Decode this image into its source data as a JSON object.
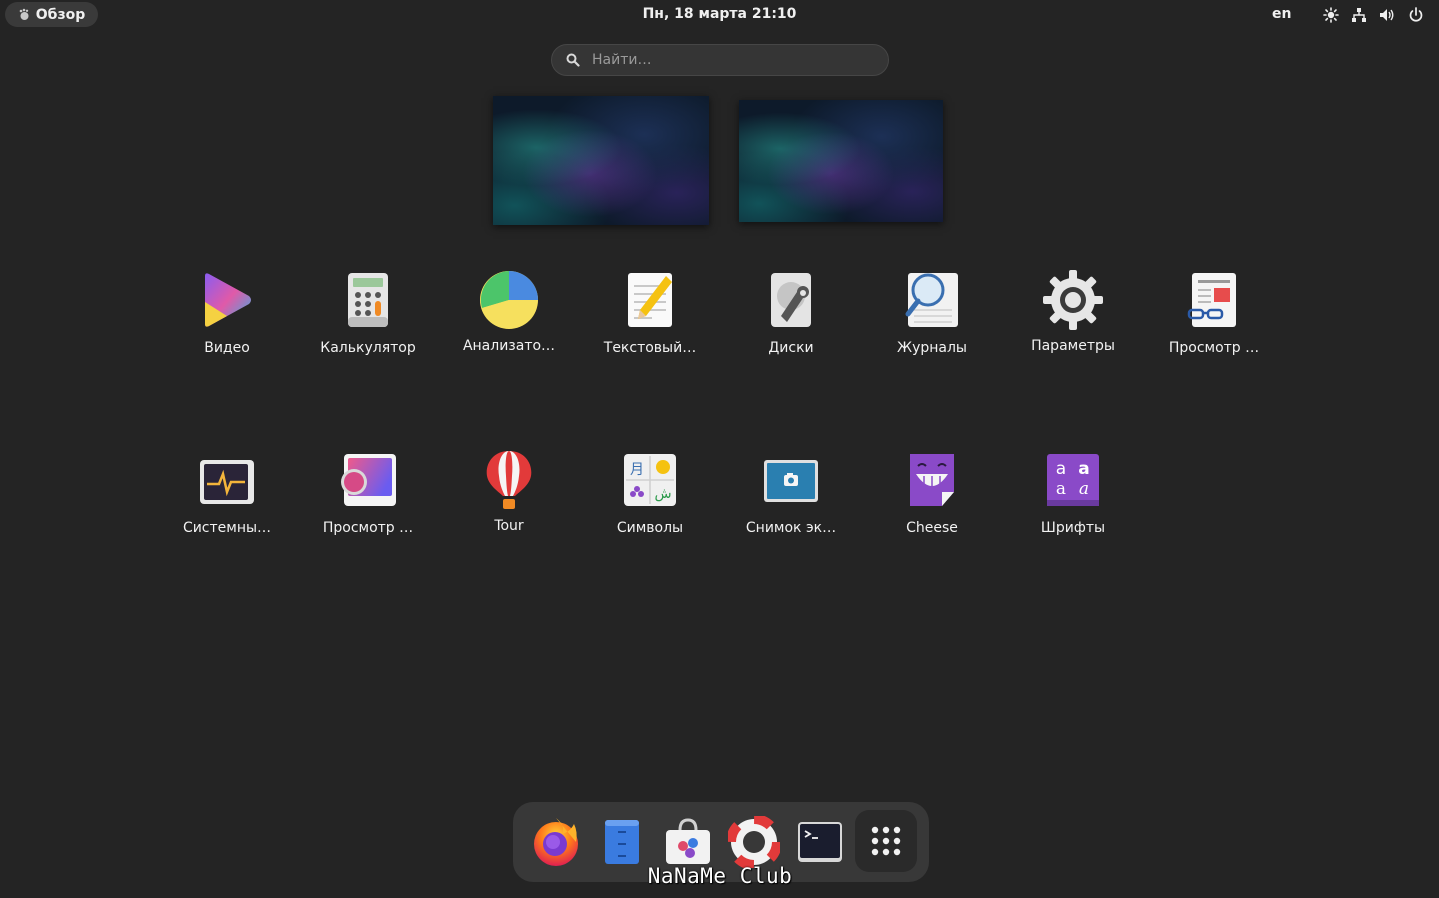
{
  "topbar": {
    "activities_label": "Обзор",
    "clock": "Пн, 18 марта  21:10",
    "keyboard_layout": "en",
    "status_icons": [
      "brightness-icon",
      "network-icon",
      "volume-icon",
      "power-icon"
    ]
  },
  "search": {
    "placeholder": "Найти…"
  },
  "apps": [
    {
      "label": "Видео",
      "icon": "video-player-icon"
    },
    {
      "label": "Калькулятор",
      "icon": "calculator-icon"
    },
    {
      "label": "Анализато…",
      "icon": "disk-usage-analyzer-icon"
    },
    {
      "label": "Текстовый…",
      "icon": "text-editor-icon"
    },
    {
      "label": "Диски",
      "icon": "disks-icon"
    },
    {
      "label": "Журналы",
      "icon": "logs-icon"
    },
    {
      "label": "Параметры",
      "icon": "settings-icon"
    },
    {
      "label": "Просмотр …",
      "icon": "document-viewer-icon"
    },
    {
      "label": "Системны…",
      "icon": "system-monitor-icon"
    },
    {
      "label": "Просмотр …",
      "icon": "image-viewer-icon"
    },
    {
      "label": "Tour",
      "icon": "tour-balloon-icon"
    },
    {
      "label": "Символы",
      "icon": "characters-icon"
    },
    {
      "label": "Снимок эк…",
      "icon": "screenshot-icon"
    },
    {
      "label": "Cheese",
      "icon": "cheese-icon"
    },
    {
      "label": "Шрифты",
      "icon": "fonts-icon"
    }
  ],
  "dash": {
    "items": [
      "firefox-icon",
      "files-icon",
      "software-icon",
      "help-icon",
      "terminal-icon"
    ],
    "show_apps_icon": "app-grid-icon"
  },
  "watermark": "NaNaMe Club"
}
